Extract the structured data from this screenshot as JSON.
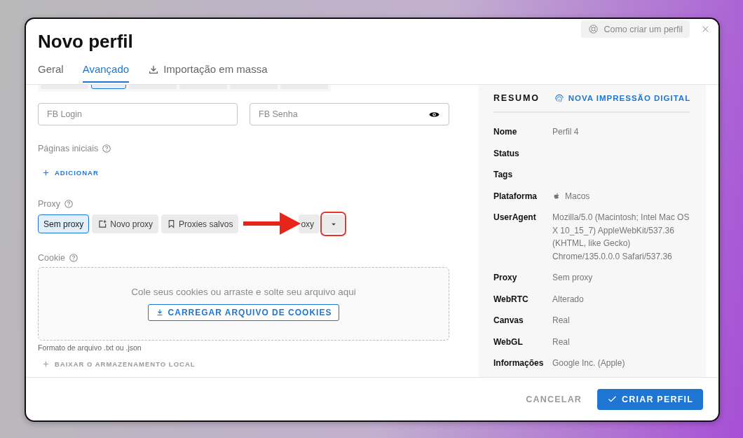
{
  "dialog": {
    "title": "Novo perfil",
    "help_button": "Como criar um perfil"
  },
  "tabs": [
    {
      "label": "Geral",
      "selected": false,
      "kind": "plain"
    },
    {
      "label": "Avançado",
      "selected": true,
      "kind": "plain"
    },
    {
      "label": "Importação em massa",
      "selected": false,
      "kind": "import"
    }
  ],
  "form": {
    "platform_chips": [
      {
        "selected": false
      },
      {
        "selected": true
      },
      {
        "selected": false
      },
      {
        "selected": false
      },
      {
        "selected": false
      },
      {
        "selected": false
      }
    ],
    "fb_login": {
      "placeholder": "FB Login"
    },
    "fb_password": {
      "placeholder": "FB Senha"
    },
    "start_pages": {
      "label": "Páginas iniciais",
      "add_button": "ADICIONAR"
    },
    "proxy": {
      "label": "Proxy",
      "options": [
        {
          "label": "Sem proxy",
          "selected": true,
          "kind": "plain"
        },
        {
          "label": "Novo proxy",
          "selected": false,
          "kind": "new"
        },
        {
          "label": "Proxies salvos",
          "selected": false,
          "kind": "saved"
        },
        {
          "label": "oxy",
          "selected": false,
          "kind": "covered"
        }
      ]
    },
    "cookie": {
      "label": "Cookie",
      "drop_hint": "Cole seus cookies ou arraste e solte seu arquivo aqui",
      "upload_button": "CARREGAR ARQUIVO DE COOKIES",
      "format_note": "Formato de arquivo .txt ou .json"
    },
    "local_storage_button": "BAIXAR O ARMAZENAMENTO LOCAL"
  },
  "summary": {
    "title": "RESUMO",
    "fingerprint_button": "NOVA IMPRESSÃO DIGITAL",
    "rows": [
      {
        "label": "Nome",
        "value": "Perfil 4",
        "kind": "text"
      },
      {
        "label": "Status",
        "kind": "text"
      },
      {
        "label": "Tags",
        "kind": "text"
      },
      {
        "label": "Plataforma",
        "value": "Macos",
        "kind": "platform"
      },
      {
        "label": "UserAgent",
        "value": "Mozilla/5.0 (Macintosh; Intel Mac OS X 10_15_7) AppleWebKit/537.36 (KHTML, like Gecko) Chrome/135.0.0.0 Safari/537.36",
        "kind": "text"
      },
      {
        "label": "Proxy",
        "value": "Sem proxy",
        "kind": "text"
      },
      {
        "label": "WebRTC",
        "value": "Alterado",
        "kind": "text"
      },
      {
        "label": "Canvas",
        "value": "Real",
        "kind": "text"
      },
      {
        "label": "WebGL",
        "value": "Real",
        "kind": "text"
      },
      {
        "label": "Informações",
        "value": "Google Inc. (Apple)",
        "kind": "text"
      }
    ]
  },
  "footer": {
    "cancel_button": "CANCELAR",
    "create_button": "CRIAR PERFIL"
  }
}
